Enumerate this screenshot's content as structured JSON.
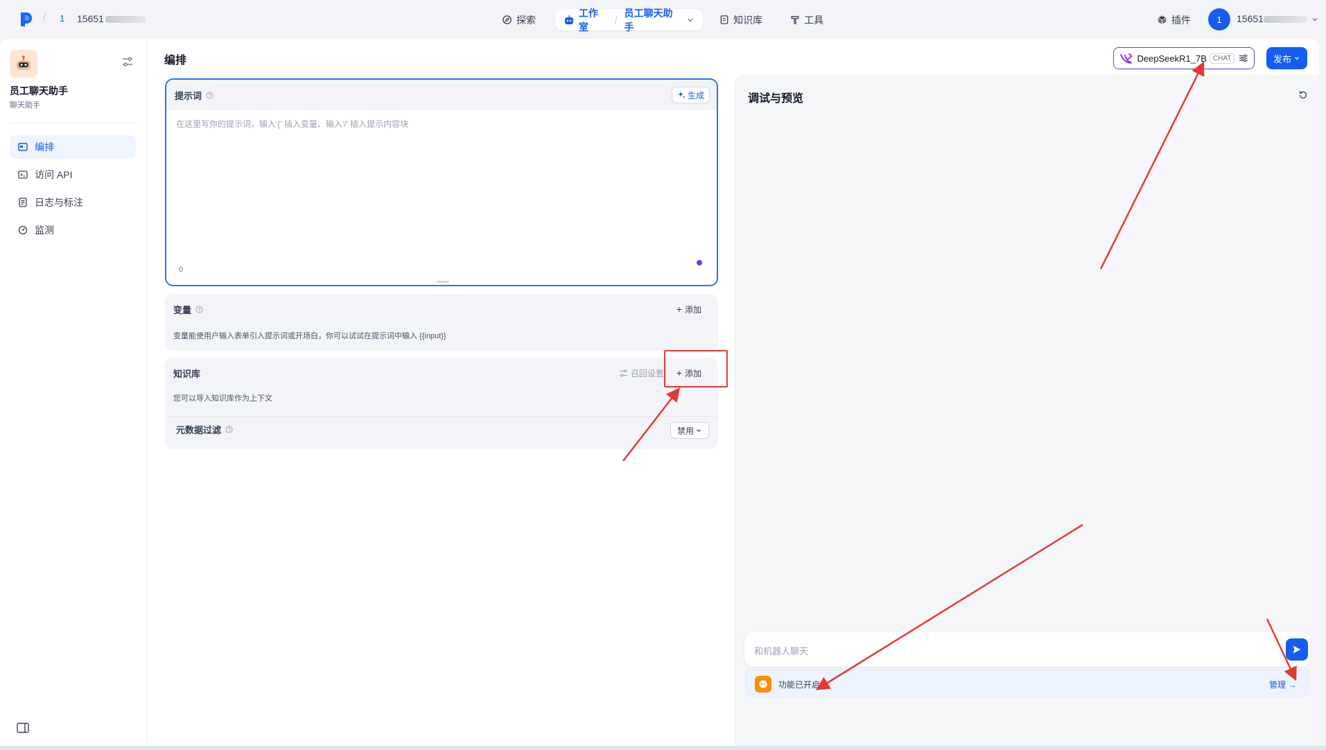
{
  "topbar": {
    "workspace_number": "1",
    "workspace_name": "15651",
    "nav": {
      "explore": "探索",
      "studio": "工作室",
      "current_app": "员工聊天助手",
      "knowledge": "知识库",
      "tools": "工具",
      "plugins": "插件"
    },
    "user_avatar": "1",
    "user_name": "15651"
  },
  "sidebar": {
    "app_title": "员工聊天助手",
    "app_subtitle": "聊天助手",
    "items": [
      {
        "label": "编排",
        "icon": "layout-icon",
        "active": true
      },
      {
        "label": "访问 API",
        "icon": "terminal-icon",
        "active": false
      },
      {
        "label": "日志与标注",
        "icon": "document-icon",
        "active": false
      },
      {
        "label": "监测",
        "icon": "gauge-icon",
        "active": false
      }
    ]
  },
  "config": {
    "title": "编排",
    "prompt": {
      "label": "提示词",
      "generate_label": "生成",
      "placeholder": "在这里写你的提示词，输入'{' 插入变量、输入'/' 插入提示内容块",
      "char_count": "0"
    },
    "variables": {
      "label": "变量",
      "add_label": "添加",
      "description": "变量能使用户输入表单引入提示词或开场白，你可以试试在提示词中输入 {{input}}"
    },
    "knowledge": {
      "label": "知识库",
      "recall_label": "召回设置",
      "add_label": "添加",
      "description": "您可以导入知识库作为上下文",
      "metadata_filter_label": "元数据过滤",
      "metadata_filter_value": "禁用"
    }
  },
  "preview": {
    "title": "调试与预览",
    "model_name": "DeepSeekR1_7B",
    "model_tag": "CHAT",
    "publish_label": "发布",
    "chat_placeholder": "和机器人聊天",
    "feature_status": "功能已开启",
    "manage_label": "管理"
  },
  "colors": {
    "accent": "#155eef",
    "annotation_red": "#e53935"
  }
}
